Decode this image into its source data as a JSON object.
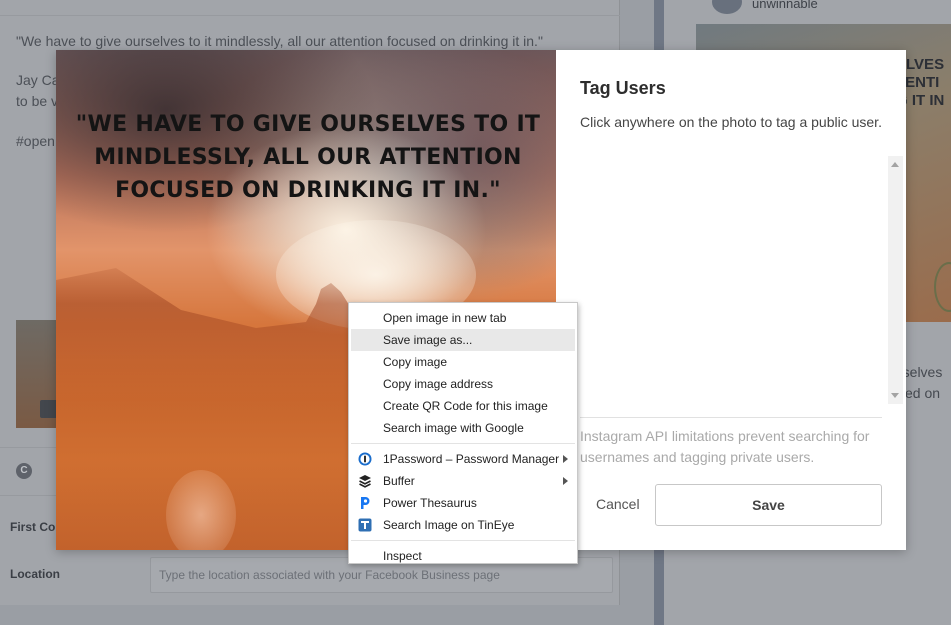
{
  "background": {
    "caption_line": "\"We have to give ourselves to it mindlessly, all our attention focused on drinking it in.\"",
    "caption_author_fragment": "Jay Ca",
    "caption_line2_fragment": "to be v",
    "hashtag_fragment": "#open",
    "first_comment_label": "First Co",
    "location_label": "Location",
    "location_placeholder": "Type the location associated with your Facebook Business page",
    "c_badge": "C",
    "right_username": "unwinnable",
    "right_image_text": "ELVES\nTENTI\nG IT IN",
    "right_text_1": "rselves",
    "right_text_2": "sed on"
  },
  "modal": {
    "photo_quote": "\"WE HAVE TO GIVE OURSELVES TO IT MINDLESSLY, ALL OUR ATTENTION FOCUSED ON DRINKING IT IN.\"",
    "panel": {
      "title": "Tag Users",
      "subtitle": "Click anywhere on the photo to tag a public user.",
      "note": "Instagram API limitations prevent searching for usernames and tagging private users.",
      "cancel_label": "Cancel",
      "save_label": "Save"
    }
  },
  "context_menu": {
    "group1": [
      {
        "label": "Open image in new tab"
      },
      {
        "label": "Save image as..."
      },
      {
        "label": "Copy image"
      },
      {
        "label": "Copy image address"
      },
      {
        "label": "Create QR Code for this image"
      },
      {
        "label": "Search image with Google"
      }
    ],
    "group2": [
      {
        "label": "1Password – Password Manager",
        "icon": "1password-icon",
        "submenu": true
      },
      {
        "label": "Buffer",
        "icon": "buffer-icon",
        "submenu": true
      },
      {
        "label": "Power Thesaurus",
        "icon": "power-thesaurus-icon",
        "submenu": false
      },
      {
        "label": "Search Image on TinEye",
        "icon": "tineye-icon",
        "submenu": false
      }
    ],
    "group3": [
      {
        "label": "Inspect"
      }
    ],
    "highlighted": "Save image as..."
  },
  "colors": {
    "overlay": "#9a9ea4",
    "modal_bg": "#ffffff",
    "menu_highlight": "#e8e8e8",
    "onepassword_blue": "#1a6dcc",
    "tineye_blue": "#2f6fb3",
    "power_thesaurus_blue": "#1877f2"
  }
}
